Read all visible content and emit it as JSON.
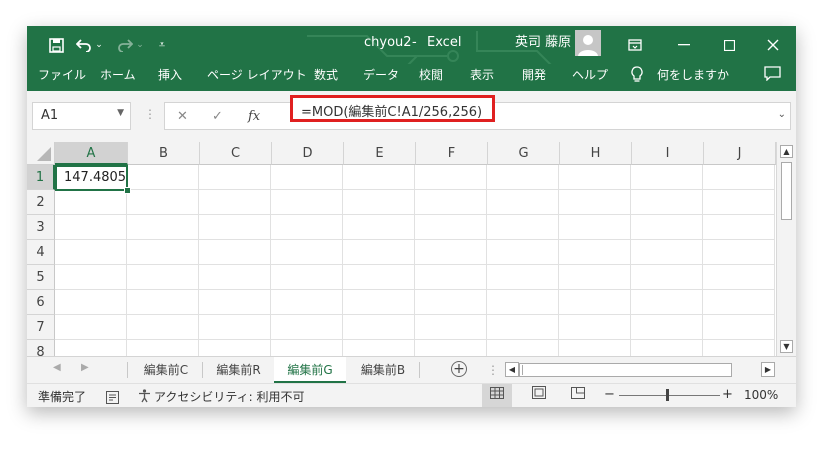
{
  "titlebar": {
    "save_icon": "save-icon",
    "undo_icon": "undo-icon",
    "redo_icon": "redo-icon",
    "qat_icon": "customize-qat-icon",
    "filename": "chyou2",
    "separator": "-",
    "app": "Excel",
    "user_name": "英司 藤原",
    "ribbon_display_icon": "ribbon-display-options-icon",
    "minimize_icon": "minimize-icon",
    "maximize_icon": "maximize-icon",
    "close_icon": "close-icon",
    "bg_color": "#217346"
  },
  "ribbon_tabs": [
    "ファイル",
    "ホーム",
    "挿入",
    "ページ レイアウト",
    "数式",
    "データ",
    "校閲",
    "表示",
    "開発",
    "ヘルプ"
  ],
  "tell_me": "何をしますか",
  "formula_bar": {
    "name_box": "A1",
    "cancel": "✕",
    "enter": "✓",
    "fx": "fx",
    "formula": "=MOD(編集前C!A1/256,256)",
    "highlight_color": "#e02020"
  },
  "grid": {
    "columns": [
      "A",
      "B",
      "C",
      "D",
      "E",
      "F",
      "G",
      "H",
      "I",
      "J"
    ],
    "rows": [
      "1",
      "2",
      "3",
      "4",
      "5",
      "6",
      "7",
      "8"
    ],
    "selected_cell": "A1",
    "cells": {
      "A1": "147.4805"
    }
  },
  "sheets": {
    "tabs": [
      "編集前C",
      "編集前R",
      "編集前G",
      "編集前B"
    ],
    "active": "編集前G"
  },
  "status": {
    "ready": "準備完了",
    "accessibility": "アクセシビリティ: 利用不可",
    "zoom_minus": "−",
    "zoom_plus": "+",
    "zoom": "100%"
  }
}
